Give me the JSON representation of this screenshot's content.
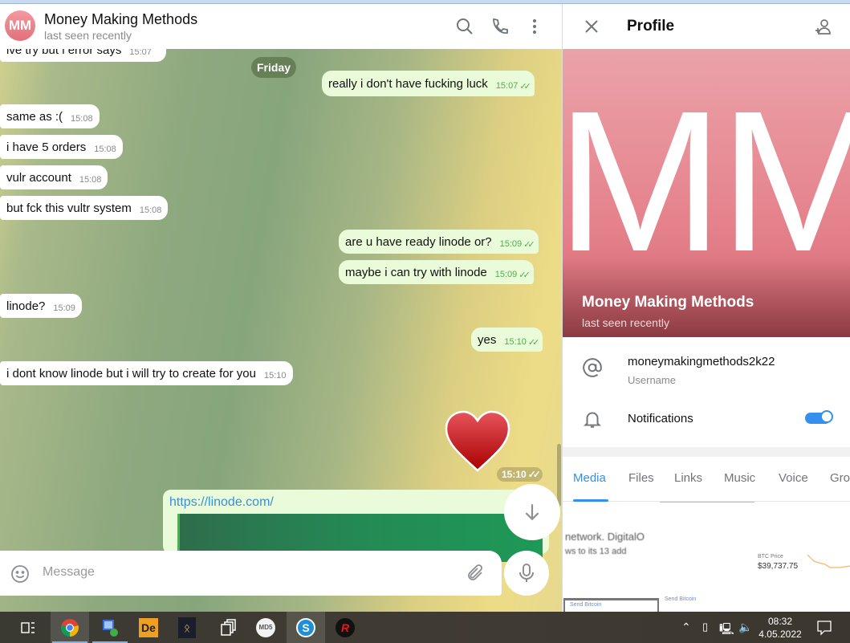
{
  "chat": {
    "title": "Money Making Methods",
    "status": "last seen recently",
    "avatar_initials": "MM",
    "date_pill": "Friday",
    "messages": [
      {
        "dir": "in",
        "text": "ive try but i error says",
        "time": "15:07"
      },
      {
        "dir": "out",
        "text": "really i don't have fucking luck",
        "time": "15:07"
      },
      {
        "dir": "in",
        "text": "same as :(",
        "time": "15:08"
      },
      {
        "dir": "in",
        "text": "i have 5 orders",
        "time": "15:08"
      },
      {
        "dir": "in",
        "text": "vulr account",
        "time": "15:08"
      },
      {
        "dir": "in",
        "text": "but fck this vultr system",
        "time": "15:08"
      },
      {
        "dir": "out",
        "text": "are u have ready linode or?",
        "time": "15:09"
      },
      {
        "dir": "out",
        "text": "maybe i can try with linode",
        "time": "15:09"
      },
      {
        "dir": "in",
        "text": "linode?",
        "time": "15:09"
      },
      {
        "dir": "out",
        "text": "yes",
        "time": "15:10"
      },
      {
        "dir": "in",
        "text": "i dont know linode but i will try to create for you",
        "time": "15:10"
      }
    ],
    "sticker": {
      "emoji": "heart",
      "time": "15:10"
    },
    "link": {
      "url": "https://linode.com/"
    },
    "input": {
      "placeholder": "Message"
    },
    "icons": [
      "search-icon",
      "phone-icon",
      "more-icon",
      "smile-icon",
      "paperclip-icon",
      "microphone-icon",
      "arrow-down-icon"
    ]
  },
  "profile": {
    "title": "Profile",
    "cover_initials": "MM",
    "name": "Money Making Methods",
    "status": "last seen recently",
    "username": "moneymakingmethods2k22",
    "username_label": "Username",
    "notifications_label": "Notifications",
    "notifications_on": true,
    "tabs": [
      "Media",
      "Files",
      "Links",
      "Music",
      "Voice",
      "Gro"
    ],
    "active_tab": "Media",
    "thumbs": {
      "t1": "network. DigitalO",
      "t1b": "ws to its 13 add",
      "t3price": "$39,737.75",
      "t3label": "BTC Price",
      "t3send": "Send Bitcoin",
      "t2send": "Send Bitcoin"
    }
  },
  "taskbar": {
    "apps": [
      "task-view",
      "chrome",
      "remote-desktop",
      "de-app",
      "app-k",
      "windows-app",
      "md5",
      "s-app",
      "redline"
    ],
    "time": "08:32",
    "date": "4.05.2022"
  },
  "colors": {
    "accent": "#3390ec",
    "outgoing": "#eafbd9",
    "check": "#4fae4e"
  }
}
